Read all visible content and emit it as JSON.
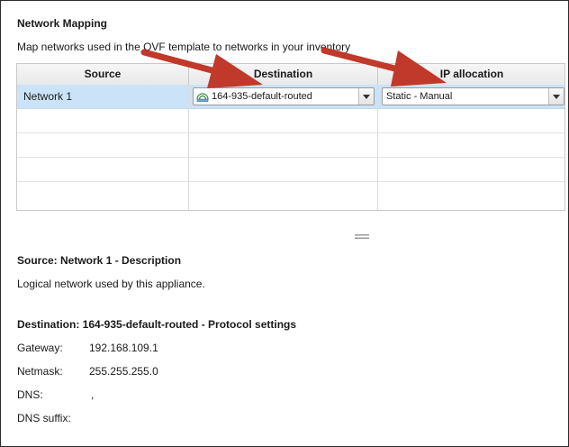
{
  "section": {
    "title": "Network Mapping",
    "subtitle": "Map networks used in the OVF template to networks in your inventory"
  },
  "table": {
    "headers": [
      "Source",
      "Destination",
      "IP allocation"
    ],
    "rows": [
      {
        "source": "Network 1",
        "destination": "164-935-default-routed",
        "ip_allocation": "Static - Manual"
      }
    ]
  },
  "details": {
    "source_heading": "Source: Network 1 - Description",
    "source_description": "Logical network used by this appliance.",
    "destination_heading": "Destination: 164-935-default-routed - Protocol settings",
    "settings": [
      {
        "label": "Gateway:",
        "value": "192.168.109.1"
      },
      {
        "label": "Netmask:",
        "value": "255.255.255.0"
      },
      {
        "label": "DNS:",
        "value": ","
      },
      {
        "label": "DNS suffix:",
        "value": ""
      }
    ]
  },
  "colors": {
    "arrow": "#c0392b",
    "selected_row": "#cbe3f8",
    "header_bg": "#eeeeee"
  },
  "icons": {
    "network": "network-icon",
    "dropdown": "chevron-down-icon",
    "splitter": "drag-handle-icon"
  }
}
